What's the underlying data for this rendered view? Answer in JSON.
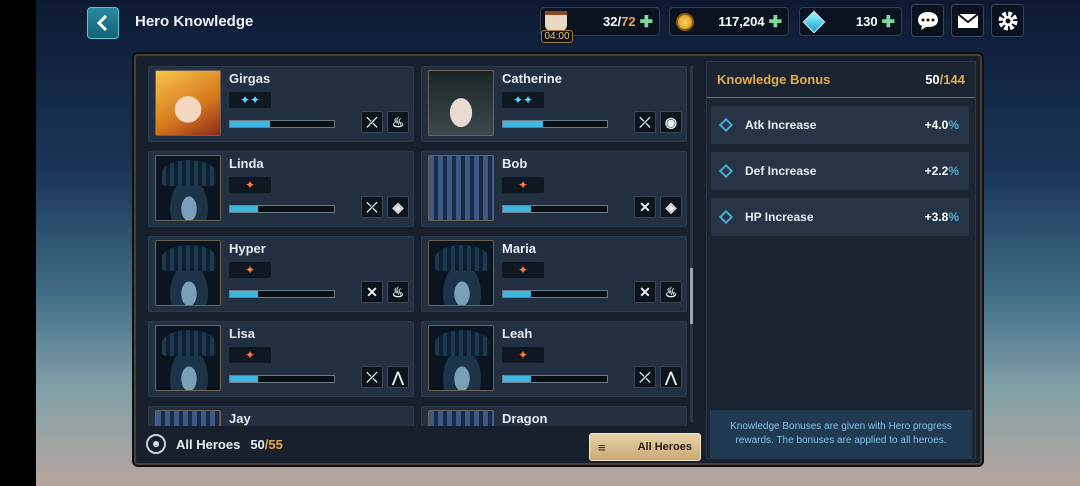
{
  "header": {
    "title": "Hero Knowledge",
    "stamina": {
      "current": "32",
      "max": "72",
      "timer": "04:00"
    },
    "gold": "117,204",
    "gems": "130"
  },
  "heroes": [
    {
      "name": "Girgas",
      "element": "✦✦",
      "progress": 0.38
    },
    {
      "name": "Catherine",
      "element": "✦✦",
      "progress": 0.38
    },
    {
      "name": "Linda",
      "element": "✦",
      "progress": 0.27
    },
    {
      "name": "Bob",
      "element": "✦",
      "progress": 0.27
    },
    {
      "name": "Hyper",
      "element": "✦",
      "progress": 0.27
    },
    {
      "name": "Maria",
      "element": "✦",
      "progress": 0.27
    },
    {
      "name": "Lisa",
      "element": "✦",
      "progress": 0.27
    },
    {
      "name": "Leah",
      "element": "✦",
      "progress": 0.27
    },
    {
      "name": "Jay",
      "element": "",
      "progress": 0.0
    },
    {
      "name": "Dragon",
      "element": "",
      "progress": 0.0
    }
  ],
  "footer": {
    "label": "All Heroes",
    "count": "50",
    "total": "55",
    "filter_label": "All Heroes"
  },
  "bonus": {
    "title": "Knowledge Bonus",
    "count": "50",
    "max": "144",
    "items": [
      {
        "label": "Atk Increase",
        "value": "+4.0",
        "unit": "%"
      },
      {
        "label": "Def Increase",
        "value": "+2.2",
        "unit": "%"
      },
      {
        "label": "HP Increase",
        "value": "+3.8",
        "unit": "%"
      }
    ],
    "note": "Knowledge Bonuses are given with Hero progress rewards. The bonuses are applied to all heroes."
  }
}
